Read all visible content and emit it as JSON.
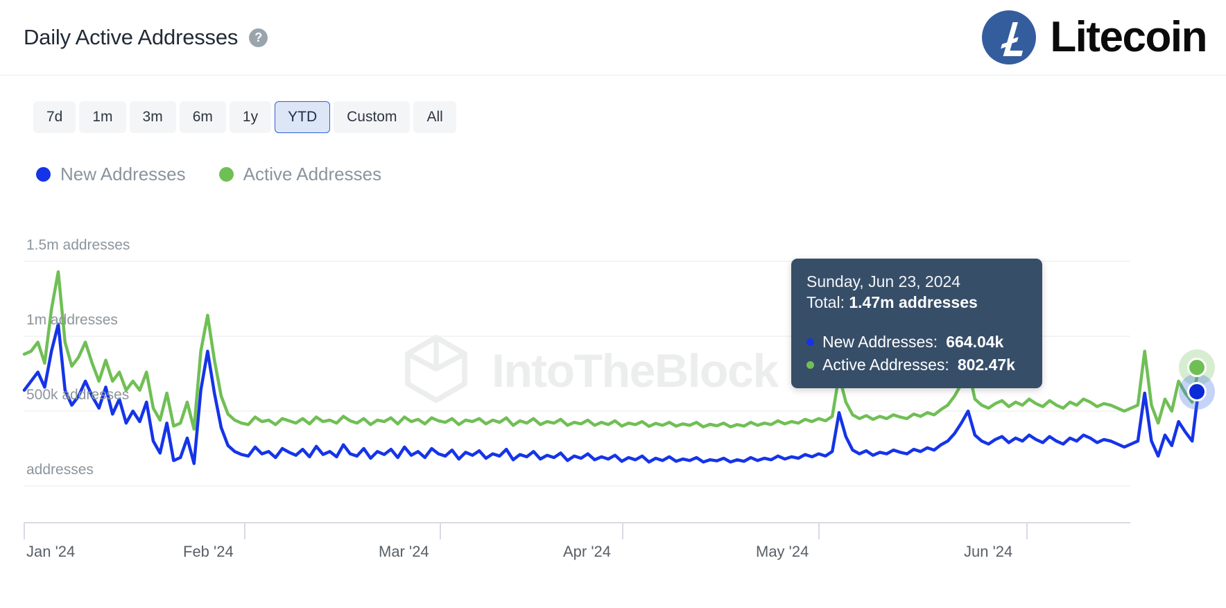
{
  "header": {
    "title": "Daily Active Addresses",
    "help_icon": "question-mark-icon",
    "brand_name": "Litecoin",
    "brand_symbol": "Ł",
    "brand_color": "#345D9D"
  },
  "range_selector": {
    "options": [
      {
        "label": "7d",
        "selected": false
      },
      {
        "label": "1m",
        "selected": false
      },
      {
        "label": "3m",
        "selected": false
      },
      {
        "label": "6m",
        "selected": false
      },
      {
        "label": "1y",
        "selected": false
      },
      {
        "label": "YTD",
        "selected": true
      },
      {
        "label": "Custom",
        "selected": false
      },
      {
        "label": "All",
        "selected": false
      }
    ],
    "selected": "YTD",
    "accent_color": "#2C62D4"
  },
  "legend": {
    "items": [
      {
        "label": "New Addresses",
        "color": "#1534E8"
      },
      {
        "label": "Active Addresses",
        "color": "#70BF55"
      }
    ]
  },
  "tooltip": {
    "date": "Sunday, Jun 23, 2024",
    "total_label": "Total:",
    "total_value": "1.47m addresses",
    "rows": [
      {
        "label": "New Addresses:",
        "value": "664.04k",
        "color": "#1534E8"
      },
      {
        "label": "Active Addresses:",
        "value": "802.47k",
        "color": "#70BF55"
      }
    ],
    "background": "#374E68"
  },
  "watermark": {
    "text": "IntoTheBlock",
    "logo": "cube-icon",
    "color": "#ECEDED"
  },
  "chart_data": {
    "type": "line",
    "title": "Daily Active Addresses",
    "xlabel": "",
    "ylabel": "addresses",
    "ylim": [
      0,
      1700000
    ],
    "grid": true,
    "legend_position": "top-left",
    "ytick_labels": [
      "1.5m addresses",
      "1m addresses",
      "500k addresses",
      "addresses"
    ],
    "ytick_values": [
      1500000,
      1000000,
      500000,
      0
    ],
    "xtick_labels": [
      "Jan '24",
      "Feb '24",
      "Mar '24",
      "Apr '24",
      "May '24",
      "Jun '24"
    ],
    "series": [
      {
        "name": "New Addresses",
        "color": "#1534E8",
        "values": [
          640000,
          700000,
          760000,
          660000,
          900000,
          1080000,
          640000,
          540000,
          600000,
          700000,
          600000,
          520000,
          660000,
          480000,
          580000,
          420000,
          500000,
          430000,
          560000,
          300000,
          220000,
          420000,
          170000,
          190000,
          320000,
          150000,
          640000,
          900000,
          620000,
          390000,
          270000,
          230000,
          210000,
          200000,
          260000,
          215000,
          230000,
          190000,
          250000,
          225000,
          205000,
          245000,
          195000,
          265000,
          210000,
          230000,
          195000,
          275000,
          215000,
          200000,
          250000,
          185000,
          230000,
          210000,
          245000,
          190000,
          260000,
          205000,
          230000,
          190000,
          250000,
          215000,
          200000,
          240000,
          180000,
          225000,
          205000,
          235000,
          185000,
          215000,
          200000,
          245000,
          175000,
          210000,
          195000,
          230000,
          180000,
          205000,
          190000,
          220000,
          170000,
          200000,
          185000,
          215000,
          175000,
          195000,
          180000,
          205000,
          165000,
          190000,
          175000,
          200000,
          160000,
          185000,
          170000,
          195000,
          165000,
          180000,
          170000,
          190000,
          160000,
          175000,
          168000,
          185000,
          160000,
          175000,
          165000,
          190000,
          170000,
          185000,
          175000,
          200000,
          180000,
          195000,
          185000,
          210000,
          195000,
          215000,
          200000,
          230000,
          490000,
          330000,
          240000,
          215000,
          235000,
          205000,
          225000,
          215000,
          240000,
          225000,
          215000,
          245000,
          230000,
          255000,
          240000,
          275000,
          300000,
          350000,
          420000,
          500000,
          340000,
          300000,
          280000,
          310000,
          330000,
          290000,
          320000,
          300000,
          340000,
          310000,
          290000,
          330000,
          300000,
          280000,
          320000,
          300000,
          340000,
          320000,
          290000,
          310000,
          300000,
          280000,
          260000,
          280000,
          300000,
          620000,
          300000,
          200000,
          340000,
          270000,
          430000,
          360000,
          300000,
          664040
        ]
      },
      {
        "name": "Active Addresses",
        "color": "#70BF55",
        "values": [
          880000,
          900000,
          960000,
          820000,
          1180000,
          1430000,
          960000,
          800000,
          860000,
          960000,
          820000,
          700000,
          840000,
          700000,
          760000,
          640000,
          700000,
          640000,
          760000,
          520000,
          440000,
          620000,
          400000,
          420000,
          560000,
          380000,
          900000,
          1140000,
          840000,
          600000,
          480000,
          440000,
          420000,
          410000,
          460000,
          430000,
          440000,
          410000,
          450000,
          435000,
          420000,
          450000,
          415000,
          460000,
          430000,
          440000,
          420000,
          465000,
          435000,
          420000,
          450000,
          410000,
          440000,
          430000,
          455000,
          415000,
          460000,
          430000,
          445000,
          415000,
          455000,
          435000,
          425000,
          450000,
          410000,
          440000,
          430000,
          450000,
          415000,
          440000,
          425000,
          455000,
          405000,
          435000,
          420000,
          450000,
          410000,
          430000,
          420000,
          445000,
          405000,
          425000,
          415000,
          440000,
          405000,
          425000,
          410000,
          435000,
          400000,
          420000,
          410000,
          430000,
          398000,
          418000,
          405000,
          425000,
          400000,
          415000,
          405000,
          425000,
          395000,
          412000,
          402000,
          420000,
          395000,
          410000,
          400000,
          425000,
          405000,
          420000,
          410000,
          435000,
          415000,
          430000,
          420000,
          445000,
          430000,
          450000,
          435000,
          465000,
          740000,
          560000,
          475000,
          450000,
          470000,
          445000,
          465000,
          450000,
          475000,
          460000,
          450000,
          480000,
          465000,
          490000,
          475000,
          510000,
          540000,
          600000,
          680000,
          790000,
          580000,
          540000,
          520000,
          550000,
          570000,
          530000,
          560000,
          540000,
          580000,
          550000,
          530000,
          570000,
          540000,
          520000,
          560000,
          540000,
          580000,
          560000,
          530000,
          550000,
          540000,
          520000,
          500000,
          520000,
          540000,
          900000,
          540000,
          420000,
          580000,
          500000,
          700000,
          620000,
          560000,
          802470
        ]
      }
    ],
    "highlight": {
      "x_fraction": 1.0,
      "points": [
        {
          "series": "Active Addresses",
          "value": 802470,
          "color": "#70BF55"
        },
        {
          "series": "New Addresses",
          "value": 664040,
          "color": "#1534E8"
        }
      ]
    }
  }
}
